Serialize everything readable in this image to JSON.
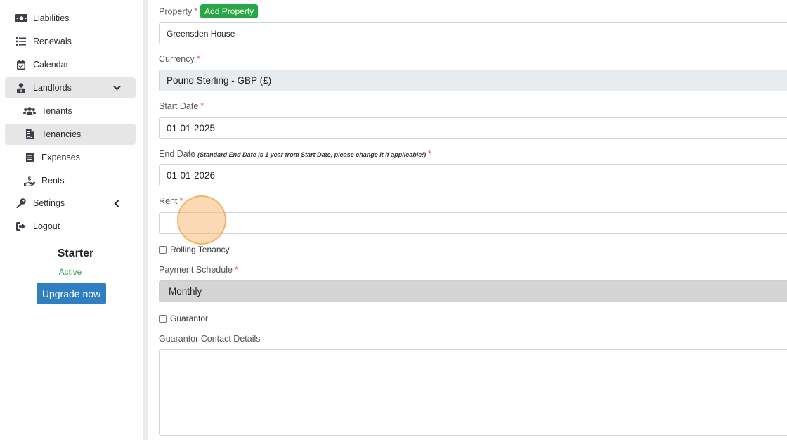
{
  "sidebar": {
    "items": [
      {
        "label": "Liabilities",
        "icon": "money-bill-icon"
      },
      {
        "label": "Renewals",
        "icon": "list-icon"
      },
      {
        "label": "Calendar",
        "icon": "calendar-check-icon"
      },
      {
        "label": "Landlords",
        "icon": "user-tie-icon"
      },
      {
        "label": "Tenants",
        "icon": "users-icon"
      },
      {
        "label": "Tenancies",
        "icon": "file-contract-icon"
      },
      {
        "label": "Expenses",
        "icon": "receipt-icon"
      },
      {
        "label": "Rents",
        "icon": "hand-holding-dollar-icon"
      },
      {
        "label": "Settings",
        "icon": "key-icon"
      },
      {
        "label": "Logout",
        "icon": "sign-out-icon"
      }
    ],
    "active_item": "Tenancies",
    "plan": {
      "name": "Starter",
      "status": "Active",
      "upgrade_label": "Upgrade now"
    }
  },
  "form": {
    "property": {
      "label": "Property",
      "add_button": "Add Property",
      "value": "Greensden House"
    },
    "currency": {
      "label": "Currency",
      "value": "Pound Sterling - GBP (£)"
    },
    "start_date": {
      "label": "Start Date",
      "value": "01-01-2025"
    },
    "end_date": {
      "label": "End Date",
      "hint": "(Standard End Date is 1 year from Start Date, please change it if applicable!)",
      "value": "01-01-2026"
    },
    "rent": {
      "label": "Rent",
      "value": ""
    },
    "rolling_tenancy": {
      "label": "Rolling Tenancy",
      "checked": false
    },
    "payment_schedule": {
      "label": "Payment Schedule",
      "value": "Monthly"
    },
    "guarantor": {
      "label": "Guarantor",
      "checked": false
    },
    "guarantor_contact": {
      "label": "Guarantor Contact Details",
      "value": ""
    },
    "required_mark": "*"
  },
  "colors": {
    "accent_blue": "#2f7fc1",
    "add_green": "#28a745",
    "required_red": "#d9534f",
    "active_nav_bg": "#e6e6e6",
    "click_marker": "#f8ba78"
  }
}
